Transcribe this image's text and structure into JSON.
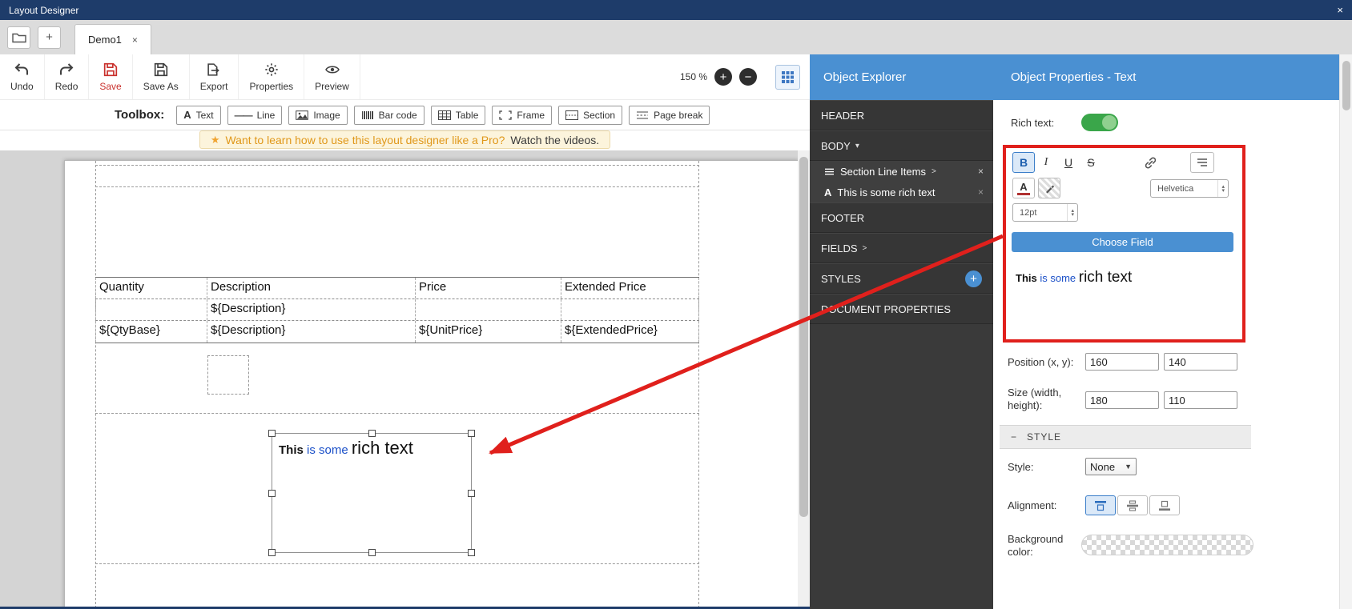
{
  "titlebar": {
    "title": "Layout Designer",
    "close_icon": "×"
  },
  "tabbar": {
    "new_tab": "+",
    "tab": {
      "label": "Demo1",
      "close": "×"
    }
  },
  "toolbar": {
    "buttons": [
      {
        "label": "Undo"
      },
      {
        "label": "Redo"
      },
      {
        "label": "Save"
      },
      {
        "label": "Save As"
      },
      {
        "label": "Export"
      },
      {
        "label": "Properties"
      },
      {
        "label": "Preview"
      }
    ],
    "zoom_level": "150 %",
    "zoom_in": "+",
    "zoom_out": "−"
  },
  "toolbox": {
    "label": "Toolbox:",
    "items": [
      {
        "label": "Text"
      },
      {
        "label": "Line"
      },
      {
        "label": "Image"
      },
      {
        "label": "Bar code"
      },
      {
        "label": "Table"
      },
      {
        "label": "Frame"
      },
      {
        "label": "Section"
      },
      {
        "label": "Page break"
      }
    ]
  },
  "notice": {
    "star": "★",
    "text": "Want to learn how to use this layout designer like a Pro?",
    "link": "Watch the videos."
  },
  "canvas": {
    "table": {
      "headers": [
        "Quantity",
        "Description",
        "Price",
        "Extended Price"
      ],
      "row_template": [
        "",
        "${Description}",
        "",
        ""
      ],
      "row_fields": [
        "${QtyBase}",
        "${Description}",
        "${UnitPrice}",
        "${ExtendedPrice}"
      ]
    },
    "text_element": {
      "bold": "This",
      "colored": " is some ",
      "large": "rich text"
    }
  },
  "explorer": {
    "title": "Object Explorer",
    "header_section": "HEADER",
    "body_section": "BODY",
    "body_chevron": "▾",
    "items": [
      {
        "label": "Section Line Items",
        "chevron": ">",
        "close": "×"
      },
      {
        "label": "This is some rich text",
        "close": "×"
      }
    ],
    "footer_section": "FOOTER",
    "fields_section": "FIELDS",
    "fields_chevron": ">",
    "styles_section": "STYLES",
    "styles_add": "+",
    "doc_props_section": "DOCUMENT PROPERTIES"
  },
  "properties": {
    "title": "Object Properties - Text",
    "rich_text_label": "Rich text:",
    "editor": {
      "bold": "B",
      "italic": "I",
      "underline": "U",
      "strike": "S",
      "font_color": "A",
      "font_name": "Helvetica",
      "font_size": "12pt",
      "choose_field": "Choose Field",
      "preview": {
        "bold": "This",
        "colored": " is some ",
        "large": "rich text"
      }
    },
    "position_label": "Position (x, y):",
    "position_x": "160",
    "position_y": "140",
    "size_label_1": "Size (width,",
    "size_label_2": "height):",
    "size_w": "180",
    "size_h": "110",
    "style_section": {
      "collapse": "−",
      "label": "STYLE"
    },
    "style_label": "Style:",
    "style_value": "None",
    "alignment_label": "Alignment:",
    "background_label_1": "Background",
    "background_label_2": "color:"
  },
  "colors": {
    "accent_blue": "#4a90d2",
    "titlebar_navy": "#1e3c6a",
    "annotation_red": "#e0201c",
    "save_red": "#c9302c",
    "toggle_green": "#3aa64a",
    "rich_text_blue": "#1b50c8"
  }
}
